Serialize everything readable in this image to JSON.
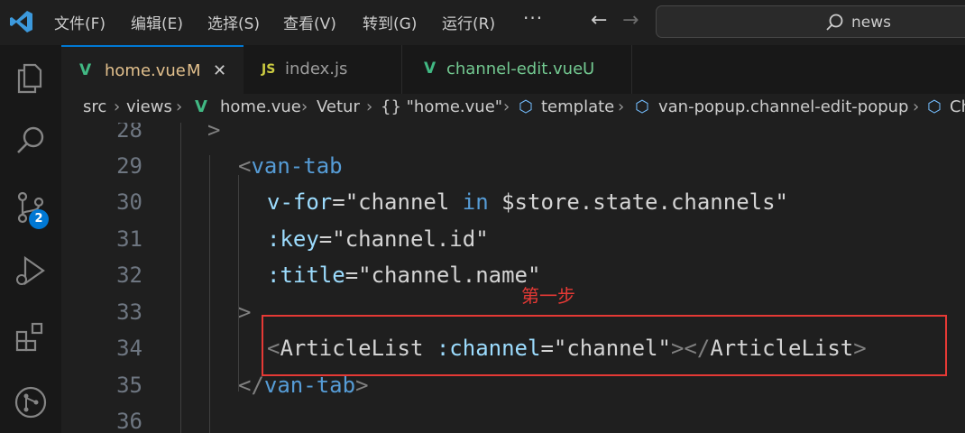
{
  "menu": {
    "items": [
      "文件(F)",
      "编辑(E)",
      "选择(S)",
      "查看(V)",
      "转到(G)",
      "运行(R)"
    ],
    "more": "···"
  },
  "search": {
    "value": "news"
  },
  "activity": {
    "scm_badge": "2"
  },
  "tabs": [
    {
      "label": "home.vue",
      "status": "M",
      "icon": "vue-icon",
      "active": true
    },
    {
      "label": "index.js",
      "icon": "JS"
    },
    {
      "label": "channel-edit.vue",
      "status": "U",
      "icon": "vue-icon"
    }
  ],
  "breadcrumb": {
    "items": [
      "src",
      "views",
      "home.vue",
      "Vetur",
      "{} \"home.vue\"",
      "template",
      "van-popup.channel-edit-popup",
      "Ch"
    ]
  },
  "editor": {
    "line_numbers": [
      "28",
      "29",
      "30",
      "31",
      "32",
      "33",
      "34",
      "35",
      "36"
    ],
    "lines": {
      "l28": ">",
      "l29_open": "<",
      "l29_tag": "van-tab",
      "l30_attr": "v-for",
      "l30_eq": "=",
      "l30_q1": "\"",
      "l30_var": "channel ",
      "l30_kw": "in",
      "l30_rest": " $store.state.channels",
      "l30_q2": "\"",
      "l31_attr": ":key",
      "l31_eq": "=",
      "l31_val": "\"channel.id\"",
      "l32_attr": ":title",
      "l32_eq": "=",
      "l32_val": "\"channel.name\"",
      "l33": ">",
      "l34_open": "<",
      "l34_tag": "ArticleList",
      "l34_attr": " :channel",
      "l34_eq": "=",
      "l34_val": "\"channel\"",
      "l34_close1": "></",
      "l34_tag2": "ArticleList",
      "l34_close2": ">",
      "l35_open": "</",
      "l35_tag": "van-tab",
      "l35_close": ">"
    }
  },
  "annotation": {
    "text": "第一步",
    "color": "#e53935"
  },
  "colors": {
    "accent": "#0078d4",
    "vue": "#41b883",
    "js": "#cbcb41"
  }
}
